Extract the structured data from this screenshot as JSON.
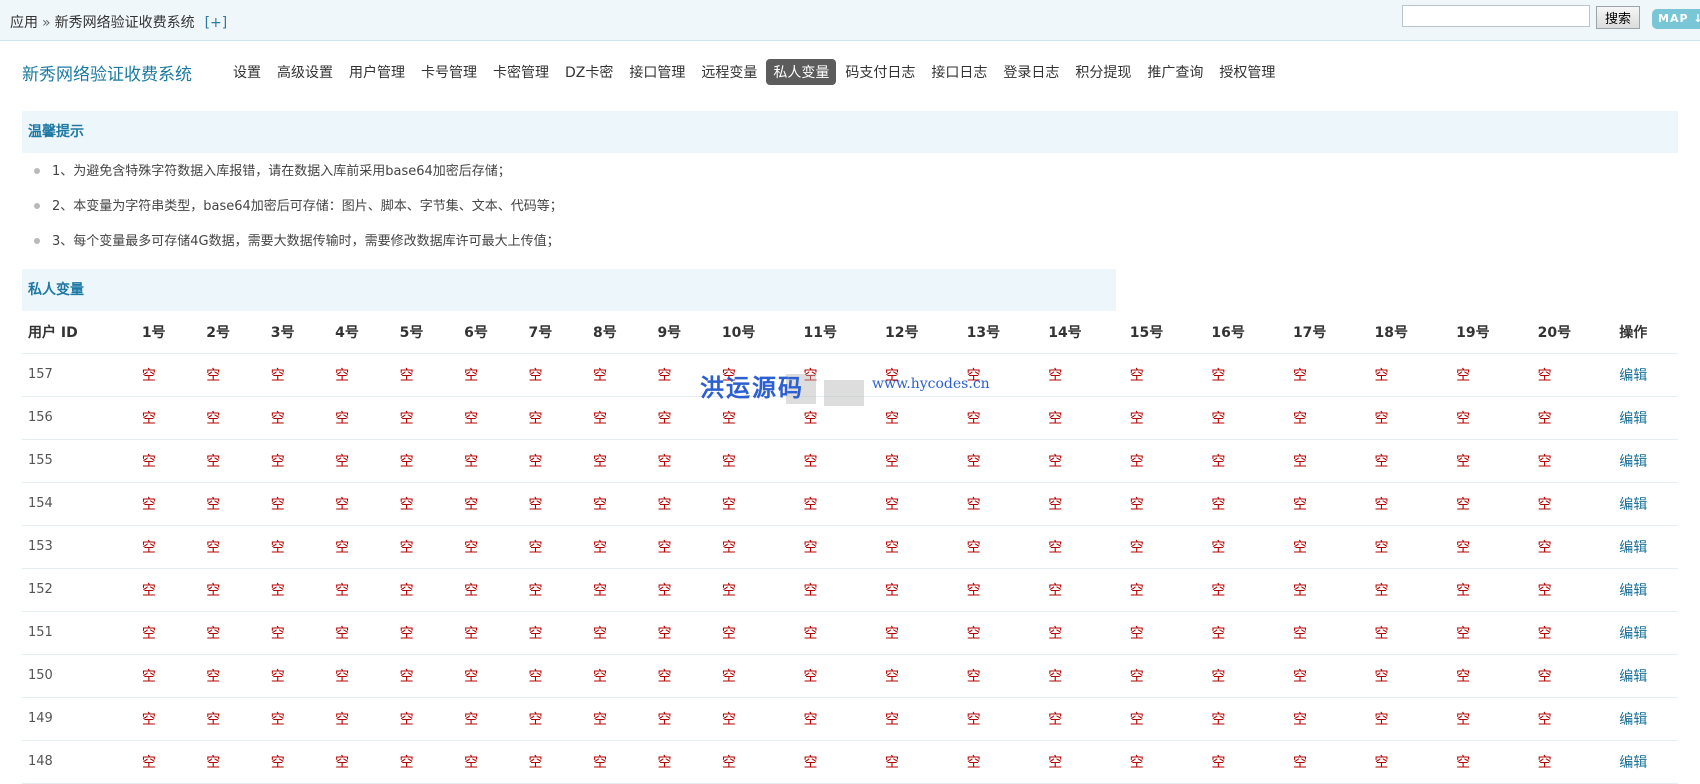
{
  "topbar": {
    "breadcrumb_root": "应用",
    "breadcrumb_sep": "»",
    "breadcrumb_current": "新秀网络验证收费系统",
    "breadcrumb_plus": "[+]",
    "search_placeholder": "",
    "search_button": "搜索",
    "map_button": "MAP"
  },
  "nav": {
    "brand": "新秀网络验证收费系统",
    "items": [
      "设置",
      "高级设置",
      "用户管理",
      "卡号管理",
      "卡密管理",
      "DZ卡密",
      "接口管理",
      "远程变量",
      "私人变量",
      "码支付日志",
      "接口日志",
      "登录日志",
      "积分提现",
      "推广查询",
      "授权管理"
    ],
    "active": "私人变量"
  },
  "tips": {
    "title": "温馨提示",
    "items": [
      "1、为避免含特殊字符数据入库报错，请在数据入库前采用base64加密后存储；",
      "2、本变量为字符串类型，base64加密后可存储：图片、脚本、字节集、文本、代码等；",
      "3、每个变量最多可存储4G数据，需要大数据传输时，需要修改数据库许可最大上传值；"
    ]
  },
  "section_title": "私人变量",
  "table": {
    "uid_header": "用户 ID",
    "slot_headers": [
      "1号",
      "2号",
      "3号",
      "4号",
      "5号",
      "6号",
      "7号",
      "8号",
      "9号",
      "10号",
      "11号",
      "12号",
      "13号",
      "14号",
      "15号",
      "16号",
      "17号",
      "18号",
      "19号",
      "20号"
    ],
    "action_header": "操作",
    "empty_label": "空",
    "edit_label": "编辑",
    "rows": [
      "157",
      "156",
      "155",
      "154",
      "153",
      "152",
      "151",
      "150",
      "149",
      "148"
    ]
  },
  "watermark": {
    "text": "洪运源码",
    "url": "www.hycodes.cn"
  },
  "colors": {
    "accent": "#1b7aa0",
    "empty_red": "#b30000",
    "active_nav": "#5c5c5c"
  }
}
